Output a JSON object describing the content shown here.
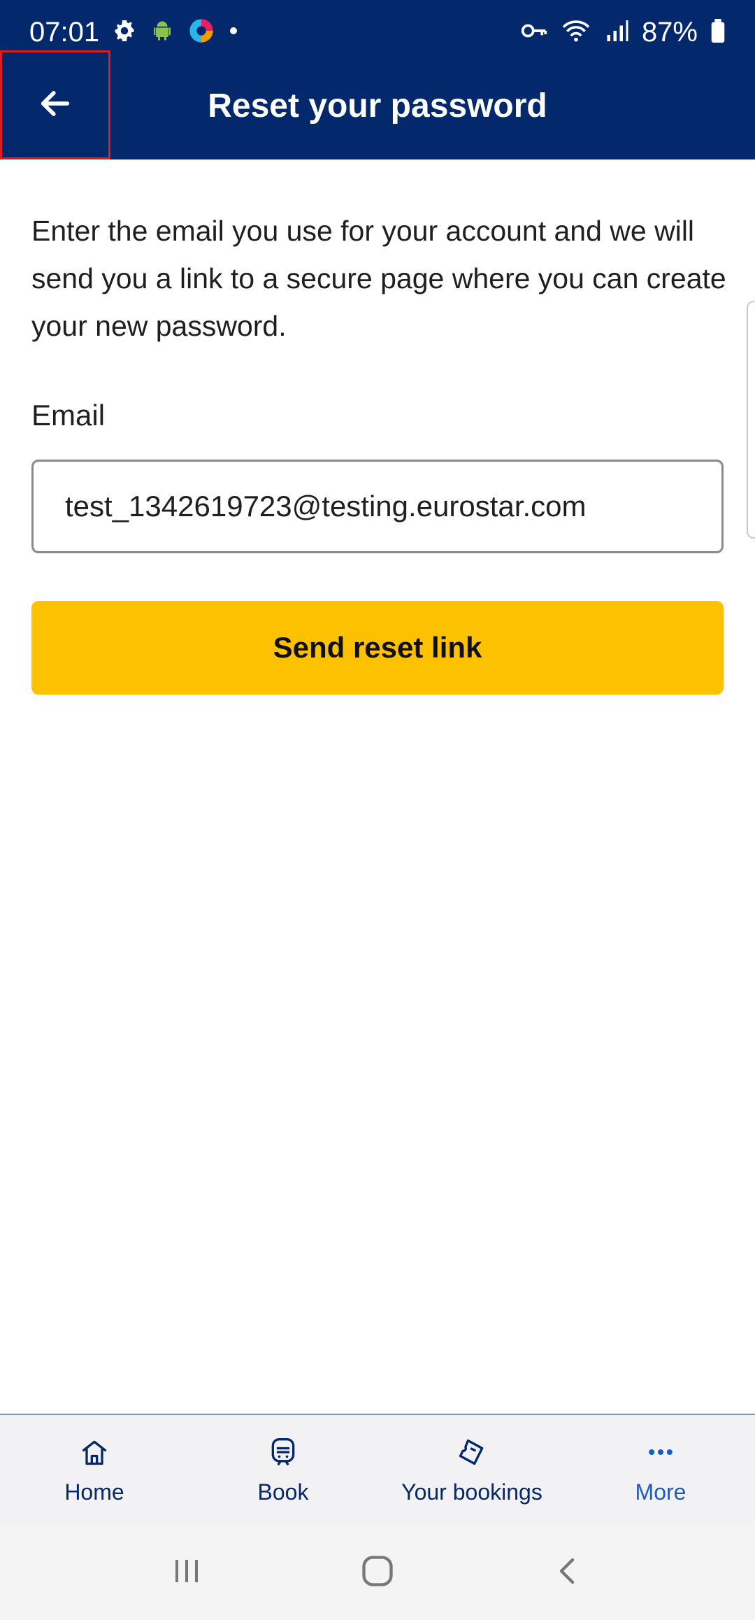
{
  "status_bar": {
    "time": "07:01",
    "battery": "87%",
    "icons_left": [
      "settings-icon",
      "android-icon",
      "app-icon",
      "dot-icon"
    ],
    "icons_right": [
      "key-icon",
      "wifi-icon",
      "signal-icon",
      "battery-icon"
    ]
  },
  "app_bar": {
    "title": "Reset your password",
    "back_icon": "arrow-left-icon"
  },
  "main": {
    "description": "Enter the email you use for your account and we will send you a link to a secure page where you can create your new password.",
    "email_label": "Email",
    "email_value": "test_1342619723@testing.eurostar.com",
    "send_button": "Send reset link"
  },
  "bottom_nav": {
    "items": [
      {
        "label": "Home",
        "icon": "home-icon"
      },
      {
        "label": "Book",
        "icon": "train-icon"
      },
      {
        "label": "Your bookings",
        "icon": "ticket-icon"
      },
      {
        "label": "More",
        "icon": "more-icon"
      }
    ]
  },
  "colors": {
    "brand_navy": "#03286b",
    "button_yellow": "#fcc201",
    "more_blue": "#1a5bc4",
    "highlight_red": "#e01b24"
  }
}
